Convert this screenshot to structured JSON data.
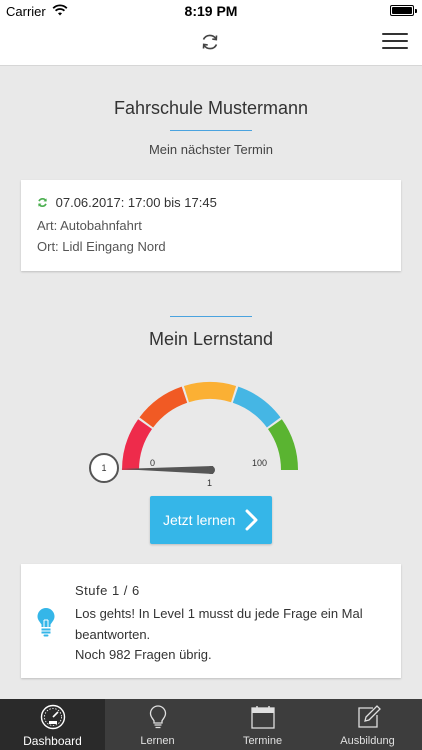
{
  "status_bar": {
    "carrier": "Carrier",
    "time": "8:19 PM"
  },
  "header": {
    "sync_icon": "sync-icon",
    "menu_icon": "hamburger-menu-icon"
  },
  "school": {
    "name": "Fahrschule Mustermann"
  },
  "appointment": {
    "heading": "Mein nächster Termin",
    "datetime": "07.06.2017: 17:00 bis 17:45",
    "type_label": "Art:",
    "type_value": "Autobahnfahrt",
    "place_label": "Ort:",
    "place_value": "Lidl Eingang Nord",
    "status_color": "#4caf50"
  },
  "progress": {
    "heading": "Mein Lernstand",
    "gauge_min": "0",
    "gauge_max": "100",
    "gauge_value": "1",
    "gauge_knob": "1",
    "value_numeric": 1,
    "segment_colors": [
      "#ee2b4b",
      "#f15a24",
      "#fbb034",
      "#45b6e4",
      "#5ab431"
    ],
    "button_label": "Jetzt lernen"
  },
  "level": {
    "stage": "Stufe 1 / 6",
    "description": "Los gehts! In Level 1 musst du jede Frage ein Mal beantworten.",
    "remaining": "Noch 982 Fragen übrig.",
    "icon": "lightbulb-icon",
    "icon_color": "#35b6e8"
  },
  "tabs": [
    {
      "label": "Dashboard",
      "icon": "speedometer-icon",
      "active": true
    },
    {
      "label": "Lernen",
      "icon": "lightbulb-icon",
      "active": false
    },
    {
      "label": "Termine",
      "icon": "calendar-icon",
      "active": false
    },
    {
      "label": "Ausbildung",
      "icon": "edit-icon",
      "active": false
    }
  ]
}
